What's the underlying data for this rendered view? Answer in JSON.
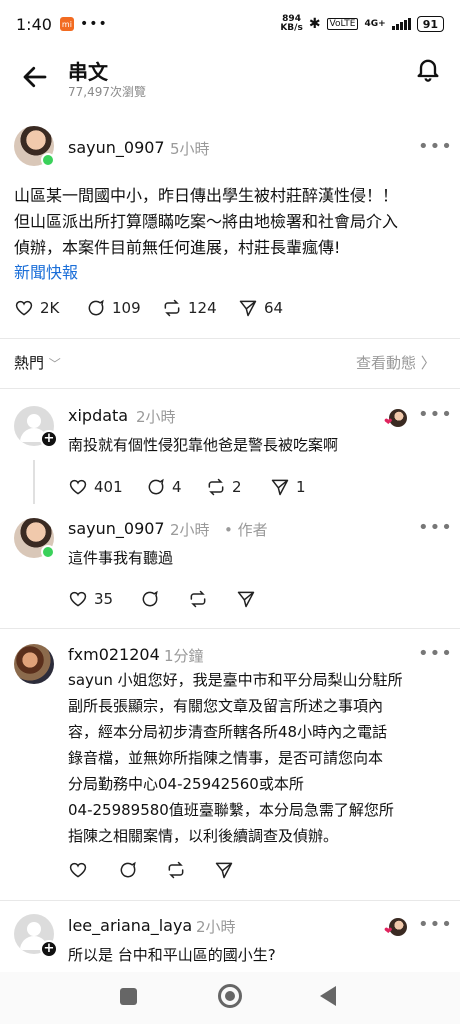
{
  "status_bar": {
    "time": "1:40",
    "mi_label": "mi",
    "dots": "•••",
    "speed_value": "894",
    "speed_unit": "KB/s",
    "network": "4G+",
    "battery": "91"
  },
  "header": {
    "title": "串文",
    "views": "77,497次瀏覽"
  },
  "post": {
    "username": "sayun_0907",
    "time": "5小時",
    "text_line1": "山區某一間國中小，昨日傳出學生被村莊醉漢性侵！！",
    "text_line2": "但山區派出所打算隱瞞吃案～將由地檢署和社會局介入",
    "text_line3": "偵辦，本案件目前無任何進展，村莊長輩瘋傳!",
    "link": "新聞快報",
    "likes": "2K",
    "comments": "109",
    "reposts": "124",
    "shares": "64"
  },
  "sort": {
    "label": "熱門",
    "chevron": "﹀",
    "view_activity": "查看動態 〉"
  },
  "replies": [
    {
      "username": "xipdata",
      "time": "2小時",
      "text": "南投就有個性侵犯靠他爸是警長被吃案啊",
      "likes": "401",
      "comments": "4",
      "reposts": "2",
      "shares": "1"
    },
    {
      "username": "sayun_0907",
      "time": "2小時",
      "author_tag": "• 作者",
      "text": "這件事我有聽過",
      "likes": "35"
    },
    {
      "username": "fxm021204",
      "time": "1分鐘",
      "text_line1": "sayun 小姐您好，我是臺中市和平分局梨山分駐所",
      "text_line2": "副所長張顯宗，有關您文章及留言所述之事項內",
      "text_line3": "容，經本分局初步清查所轄各所48小時內之電話",
      "text_line4": "錄音檔，並無妳所指陳之情事，是否可請您向本",
      "text_line5": "分局勤務中心04-25942560或本所",
      "text_line6": "04-25989580值班臺聯繫，本分局急需了解您所",
      "text_line7": "指陳之相關案情，以利後續調查及偵辦。"
    },
    {
      "username": "lee_ariana_laya",
      "time": "2小時",
      "text": "所以是 台中和平山區的國小生?"
    }
  ],
  "more_label": "•••",
  "plus_label": "+"
}
